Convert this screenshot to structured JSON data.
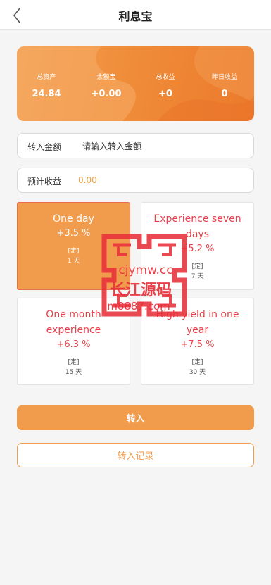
{
  "header": {
    "title": "利息宝"
  },
  "summary": {
    "items": [
      {
        "label": "总资产",
        "value": "24.84"
      },
      {
        "label": "余额宝",
        "value": "+0.00"
      },
      {
        "label": "总收益",
        "value": "+0"
      },
      {
        "label": "昨日收益",
        "value": "0"
      }
    ]
  },
  "transfer_field": {
    "label": "转入金额",
    "placeholder": "请输入转入金额"
  },
  "estimate_field": {
    "label": "预计收益",
    "value": "0.00"
  },
  "plans": [
    {
      "name": "One day",
      "rate": "+3.5 %",
      "type": "[定]",
      "days": "1 天",
      "selected": true
    },
    {
      "name": "Experience seven days",
      "rate": "+5.2 %",
      "type": "[定]",
      "days": "7 天",
      "selected": false
    },
    {
      "name": "One month experience",
      "rate": "+6.3 %",
      "type": "[定]",
      "days": "15 天",
      "selected": false
    },
    {
      "name": "High yield in one year",
      "rate": "+7.5 %",
      "type": "[定]",
      "days": "30 天",
      "selected": false
    }
  ],
  "buttons": {
    "transfer": "转入",
    "records": "转入记录"
  },
  "watermark": {
    "line1": "cjymw.cc",
    "line2": "长江源码",
    "line3": "m8887.com"
  },
  "colors": {
    "accent": "#f19b4c",
    "deep_orange": "#ec7a2b",
    "rate_red": "#e8404a",
    "watermark_red": "#e8303a"
  }
}
